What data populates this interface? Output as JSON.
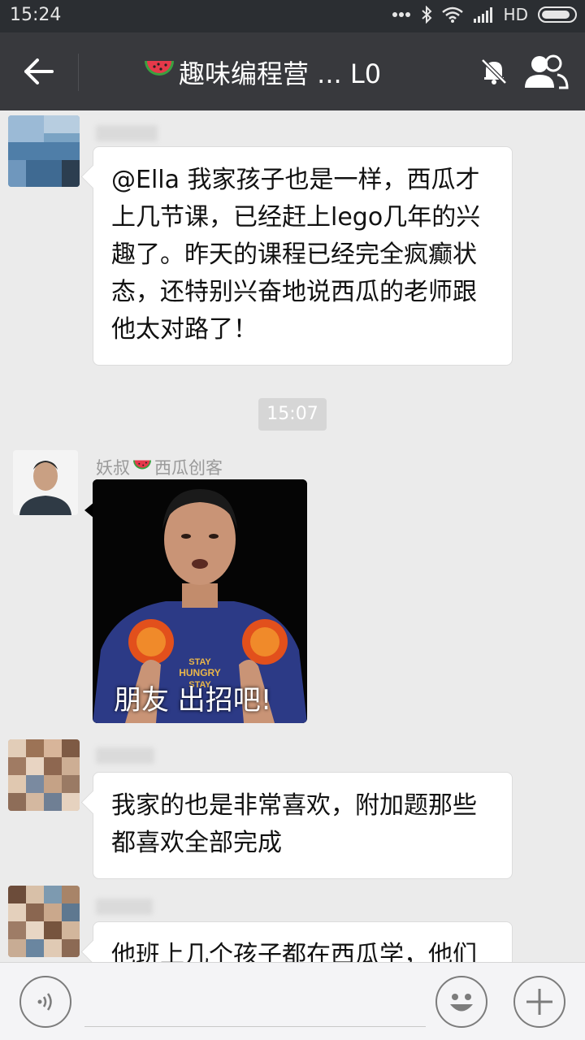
{
  "status_bar": {
    "time": "15:24",
    "network": "HD",
    "icons": [
      "more-dots-icon",
      "bluetooth-icon",
      "wifi-icon",
      "signal-icon",
      "battery-icon"
    ]
  },
  "header": {
    "title": "趣味编程营 ... L0",
    "title_emoji": "watermelon-emoji",
    "icons": [
      "back-arrow-icon",
      "mute-bell-icon",
      "group-members-icon"
    ]
  },
  "messages": [
    {
      "type": "text",
      "lines": [
        "@Ella 我家孩子也是一样，西瓜才",
        "上几节课，已经赶上lego几年的兴",
        "趣了。昨天的课程已经完全疯癫状",
        "态，还特别兴奋地说西瓜的老师跟",
        "他太对路了！"
      ]
    },
    {
      "type": "time",
      "text": "15:07"
    },
    {
      "type": "image",
      "sender_a": "妖叔",
      "sender_b": "西瓜创客",
      "caption": "朋友 出招吧!",
      "shirt_text": [
        "STAY",
        "HUNGRY",
        "STAY"
      ]
    },
    {
      "type": "text",
      "lines": [
        "我家的也是非常喜欢，附加题那些",
        "都喜欢全部完成"
      ]
    },
    {
      "type": "text",
      "lines": [
        "他班上几个孩子都在西瓜学，他们"
      ]
    }
  ],
  "colors": {
    "status_bg": "#2b2e32",
    "appbar_bg": "#38393d",
    "chat_bg": "#ebebeb",
    "bubble_bg": "#ffffff"
  }
}
